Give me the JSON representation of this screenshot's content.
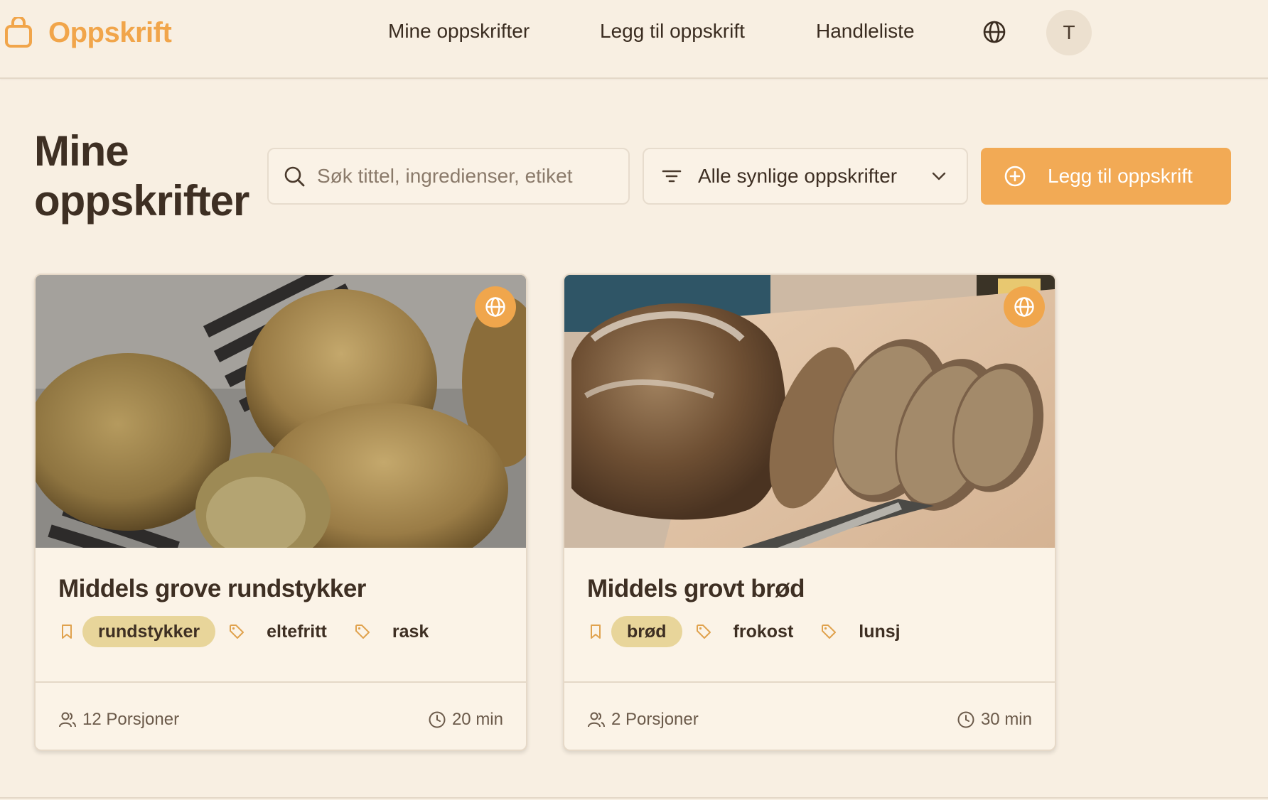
{
  "brand": {
    "name": "Oppskrift"
  },
  "nav": {
    "links": [
      "Mine oppskrifter",
      "Legg til oppskrift",
      "Handleliste"
    ],
    "avatar_initial": "T"
  },
  "page": {
    "title": "Mine oppskrifter",
    "search_placeholder": "Søk tittel, ingredienser, etiket",
    "search_value": "",
    "filter_label": "Alle synlige oppskrifter",
    "add_button_label": "Legg til oppskrift"
  },
  "colors": {
    "accent": "#f2aa55",
    "background": "#f8efe2",
    "card": "#fbf3e7",
    "pill": "#e8d59a",
    "text": "#3e2f23"
  },
  "recipes": [
    {
      "title": "Middels grove rundstykker",
      "primary_tag": "rundstykker",
      "tags": [
        "eltefritt",
        "rask"
      ],
      "servings": "12 Porsjoner",
      "time": "20 min",
      "image_icon": "bread-rolls-photo"
    },
    {
      "title": "Middels grovt brød",
      "primary_tag": "brød",
      "tags": [
        "frokost",
        "lunsj"
      ],
      "servings": "2 Porsjoner",
      "time": "30 min",
      "image_icon": "bread-loaf-photo"
    }
  ]
}
